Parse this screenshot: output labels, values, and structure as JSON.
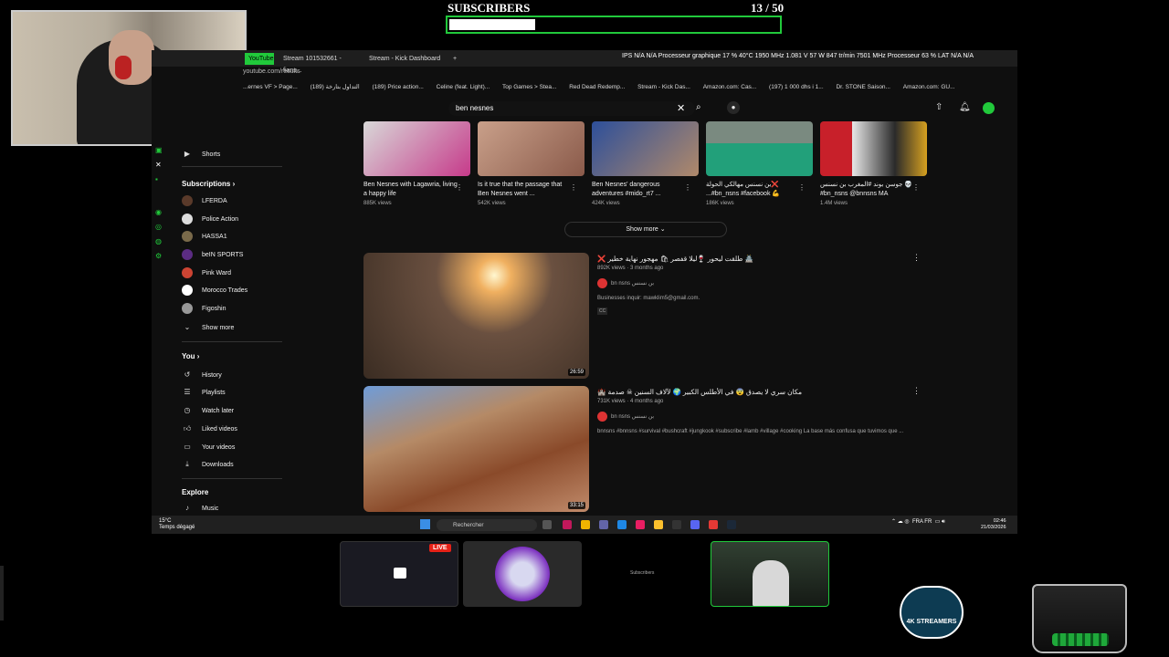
{
  "overlay": {
    "title": "SUBSCRIBERS",
    "count": "13 / 50",
    "progress": 0.26,
    "accent": "#21c93b"
  },
  "browser": {
    "tabs": [
      "YouTube",
      "Stream 101532661 - fians...",
      "Stream - Kick Dashboard",
      "+"
    ],
    "url": "youtube.com/results",
    "bookmarks": [
      "...ernes VF > Page...",
      "التداول بتارخة (189)",
      "(189) Price action...",
      "Celine (feat. Light)...",
      "Top Games > Stea...",
      "Red Dead Redemp...",
      "Stream - Kick Das...",
      "Amazon.com: Cas...",
      "(197) 1 000 dhs i 1...",
      "Dr. STONE Saison...",
      "Amazon.com: GU..."
    ],
    "stats": "IPS N/A N/A   Processeur graphique   17 % 40°C 1950 MHz 1.081 V 57 W 847 tr/min 7501 MHz   Processeur 63 %   LAT N/A N/A"
  },
  "youtube": {
    "search_query": "ben nesnes",
    "sidebar": {
      "shorts": "Shorts",
      "subscriptions_header": "Subscriptions",
      "subscriptions": [
        "LFERDA",
        "Police Action",
        "HASSA1",
        "beIN SPORTS",
        "Pink Ward",
        "Morocco Trades",
        "Figoshin"
      ],
      "show_more": "Show more",
      "you_header": "You",
      "you_items": [
        "History",
        "Playlists",
        "Watch later",
        "Liked videos",
        "Your videos",
        "Downloads"
      ],
      "explore_header": "Explore",
      "explore_items": [
        "Music"
      ]
    },
    "shorts": [
      {
        "title": "Ben Nesnes with Lagawria, living a happy life",
        "views": "885K views"
      },
      {
        "title": "Is it true that the passage that Ben Nesnes went ...",
        "views": "542K views"
      },
      {
        "title": "Ben Nesnes' dangerous adventures #mido_rt7 ...",
        "views": "424K views"
      },
      {
        "title": "بن نسنس مهالكي الحولة❌ ...#bn_nsns #facebook 💪",
        "views": "186K views"
      },
      {
        "title": "جوسن بوند #المغرب بن نسنس 💀 #bn_nsns @bnnsns MA",
        "views": "1.4M views"
      }
    ],
    "show_more_label": "Show more",
    "results": [
      {
        "title": "❌ طلقت ليحور 🍷ليلا قفصر 🛍 مهجور نهاية خطير 🏯",
        "meta": "892K views · 3 months ago",
        "channel": "bn nsns بن نسنس",
        "description": "Businesses inquir: mawklim5@gmail.com.",
        "badge": "CC",
        "duration": "26:59"
      },
      {
        "title": "🏰 مكان سري لا يصدق 😨 في الأطلس الكبير 🌍 لآلاف السنين ☠ صدمة",
        "meta": "731K views · 4 months ago",
        "channel": "bn nsns بن نسنس",
        "description": "bnnsns #bnnsns #survival #bushcraft #jungkook #subscribe #lamb #village #cooking La base más confusa que tuvimos que ...",
        "duration": "33:15"
      }
    ]
  },
  "taskbar": {
    "weather_temp": "15°C",
    "weather_desc": "Temps dégagé",
    "search_placeholder": "Rechercher",
    "lang": "FRA FR",
    "time": "02:46",
    "date": "21/03/2026"
  },
  "bottom": {
    "live_badge": "LIVE",
    "panel3_label": "Subscribers",
    "logo_text": "4K STREAMERS"
  }
}
